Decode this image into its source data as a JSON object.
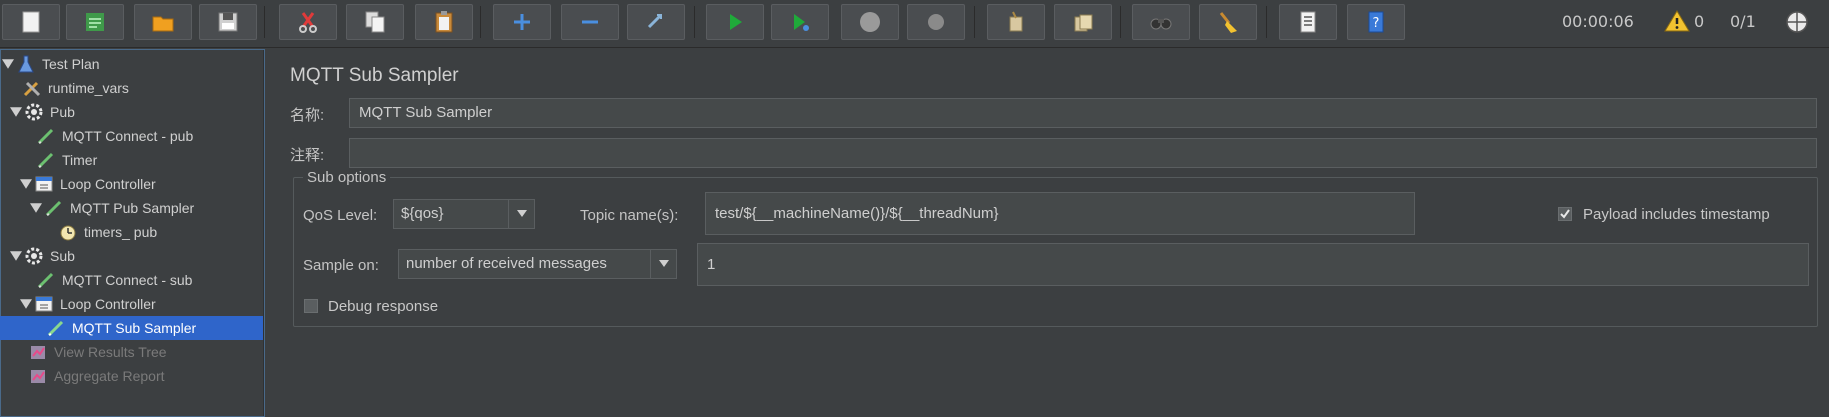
{
  "toolbar": {
    "buttons": [
      {
        "name": "new-button",
        "icon": "new-document-icon"
      },
      {
        "name": "templates-button",
        "icon": "templates-icon"
      },
      {
        "name": "open-button",
        "icon": "open-folder-icon"
      },
      {
        "name": "save-button",
        "icon": "save-icon"
      },
      {
        "name": "cut-button",
        "icon": "scissors-icon"
      },
      {
        "name": "copy-button",
        "icon": "copy-icon"
      },
      {
        "name": "paste-button",
        "icon": "paste-icon"
      },
      {
        "name": "expand-button",
        "icon": "plus-icon"
      },
      {
        "name": "collapse-button",
        "icon": "minus-icon"
      },
      {
        "name": "toggle-button",
        "icon": "toggle-icon"
      },
      {
        "name": "start-button",
        "icon": "play-icon"
      },
      {
        "name": "start-no-pause-button",
        "icon": "play-no-pause-icon"
      },
      {
        "name": "stop-button",
        "icon": "stop-icon"
      },
      {
        "name": "shutdown-button",
        "icon": "shutdown-icon"
      },
      {
        "name": "clear-button",
        "icon": "clear-broom-icon"
      },
      {
        "name": "clear-all-button",
        "icon": "clear-all-icon"
      },
      {
        "name": "search-button",
        "icon": "binoculars-icon"
      },
      {
        "name": "reset-search-button",
        "icon": "broom-icon"
      },
      {
        "name": "function-helper-button",
        "icon": "function-list-icon"
      },
      {
        "name": "help-button",
        "icon": "help-icon"
      }
    ],
    "elapsed_time": "00:00:06",
    "warning_count": "0",
    "thread_count": "0/1"
  },
  "tree": {
    "items": [
      {
        "label": "Test Plan",
        "icon": "test-plan-icon",
        "level": 0,
        "expanded": true
      },
      {
        "label": "runtime_vars",
        "icon": "config-element-icon",
        "level": 1
      },
      {
        "label": "Pub",
        "icon": "thread-group-gear-icon",
        "level": 0,
        "expanded": true
      },
      {
        "label": "MQTT Connect - pub",
        "icon": "sampler-pen-icon",
        "level": 1
      },
      {
        "label": "Timer",
        "icon": "sampler-pen-icon",
        "level": 1
      },
      {
        "label": "Loop Controller",
        "icon": "loop-controller-icon",
        "level": 1,
        "expanded": true
      },
      {
        "label": "MQTT Pub Sampler",
        "icon": "sampler-pen-icon",
        "level": 2,
        "expanded": true
      },
      {
        "label": "timers_ pub",
        "icon": "timer-clock-icon",
        "level": 3
      },
      {
        "label": "Sub",
        "icon": "thread-group-gear-icon",
        "level": 0,
        "expanded": true
      },
      {
        "label": "MQTT Connect - sub",
        "icon": "sampler-pen-icon",
        "level": 1
      },
      {
        "label": "Loop Controller",
        "icon": "loop-controller-icon",
        "level": 1,
        "expanded": true
      },
      {
        "label": "MQTT Sub Sampler",
        "icon": "sampler-pen-icon",
        "level": 2,
        "selected": true
      },
      {
        "label": "View Results Tree",
        "icon": "listener-chart-icon",
        "level": 1,
        "disabled": true
      },
      {
        "label": "Aggregate Report",
        "icon": "listener-chart-icon",
        "level": 1,
        "disabled": true
      }
    ]
  },
  "panel": {
    "title": "MQTT Sub Sampler",
    "name_label": "名称:",
    "name_value": "MQTT Sub Sampler",
    "comment_label": "注释:",
    "comment_value": "",
    "sub_options_legend": "Sub options",
    "qos_label": "QoS Level:",
    "qos_value": "${qos}",
    "topic_label": "Topic name(s):",
    "topic_value": "test/${__machineName()}/${__threadNum}",
    "payload_timestamp_label": "Payload includes timestamp",
    "payload_timestamp_checked": true,
    "sample_on_label": "Sample on:",
    "sample_on_value": "number of received messages",
    "sample_count_value": "1",
    "debug_response_label": "Debug response",
    "debug_response_checked": false
  },
  "colors": {
    "background": "#3c3f41",
    "selection": "#2f65ca",
    "field_bg": "#45494a"
  }
}
